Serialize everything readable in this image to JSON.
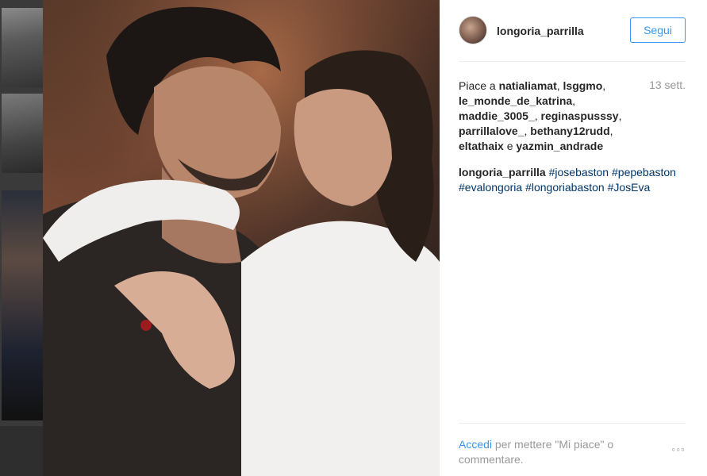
{
  "post": {
    "username": "longoria_parrilla",
    "follow_label": "Segui",
    "likes_prefix": "Piace a",
    "likers": [
      "natialiamat",
      "lsggmo",
      "le_monde_de_katrina",
      "maddie_3005_",
      "reginaspusssy",
      "parrillalove_",
      "bethany12rudd",
      "eltathaix"
    ],
    "likes_conjunction": "e",
    "last_liker": "yazmin_andrade",
    "timestamp": "13 sett.",
    "caption_user": "longoria_parrilla",
    "hashtags": [
      "#josebaston",
      "#pepebaston",
      "#evalongoria",
      "#longoriabaston",
      "#JosEva"
    ],
    "login_link": "Accedi",
    "login_rest": "per mettere \"Mi piace\" o commentare.",
    "more_label": "◦◦◦"
  },
  "colors": {
    "accent": "#3897f0",
    "hashtag": "#003569",
    "muted": "#999999",
    "text": "#262626"
  },
  "icons": {
    "avatar": "profile-avatar",
    "more": "ellipsis-icon"
  }
}
